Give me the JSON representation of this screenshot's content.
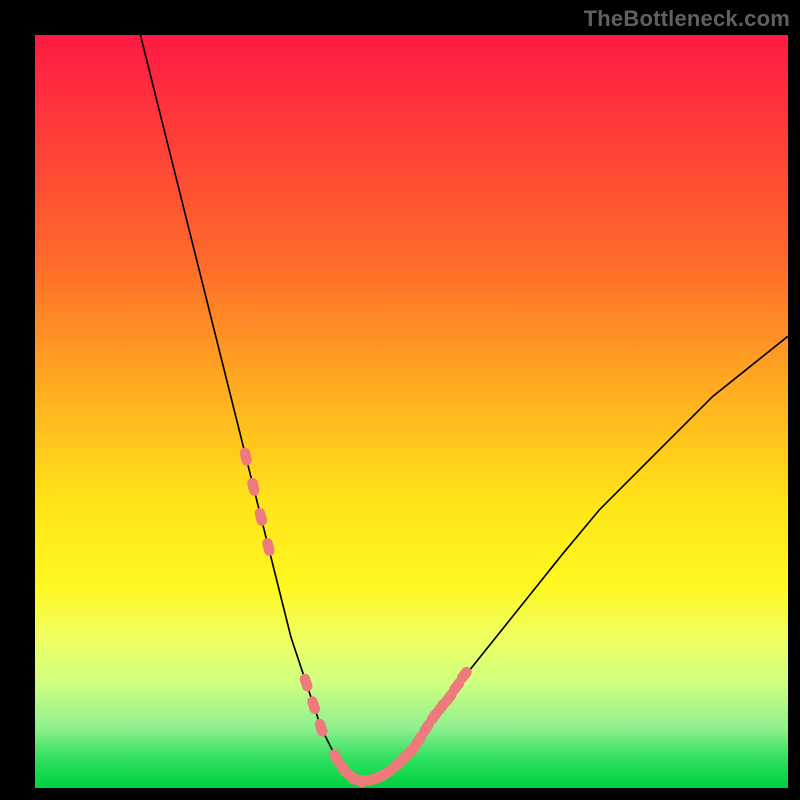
{
  "watermark": "TheBottleneck.com",
  "colors": {
    "background_frame": "#000000",
    "gradient_top": "#ff1a44",
    "gradient_bottom": "#00d040",
    "curve_stroke": "#000000",
    "marker_fill": "#ed7b7b"
  },
  "chart_data": {
    "type": "line",
    "title": "",
    "xlabel": "",
    "ylabel": "",
    "xlim": [
      0,
      100
    ],
    "ylim": [
      0,
      100
    ],
    "x": [
      14,
      16,
      18,
      20,
      22,
      24,
      25,
      26,
      27,
      28,
      29,
      30,
      31,
      32,
      33,
      34,
      35,
      36,
      37,
      38,
      39,
      40,
      41,
      42,
      43,
      44,
      45,
      46,
      48,
      50,
      52,
      55,
      58,
      62,
      66,
      70,
      75,
      80,
      85,
      90,
      95,
      100
    ],
    "values": [
      100,
      92,
      84,
      76,
      68,
      60,
      56,
      52,
      48,
      44,
      40,
      36,
      32,
      28,
      24,
      20,
      17,
      14,
      11,
      8,
      6,
      4,
      2.5,
      1.5,
      1,
      1,
      1.2,
      1.6,
      3,
      5,
      8,
      12,
      16,
      21,
      26,
      31,
      37,
      42,
      47,
      52,
      56,
      60
    ],
    "markers": {
      "x": [
        28,
        29,
        30,
        31,
        36,
        37,
        38,
        40,
        41,
        42,
        43,
        44,
        45,
        46,
        47,
        48,
        49,
        50,
        51,
        52,
        53,
        54,
        55,
        56,
        57
      ],
      "values": [
        44,
        40,
        36,
        32,
        14,
        11,
        8,
        4,
        2.5,
        1.5,
        1,
        1,
        1.2,
        1.6,
        2.2,
        3,
        4,
        5,
        6.4,
        8,
        9.5,
        10.8,
        12,
        13.5,
        15
      ],
      "style": "pill"
    }
  }
}
